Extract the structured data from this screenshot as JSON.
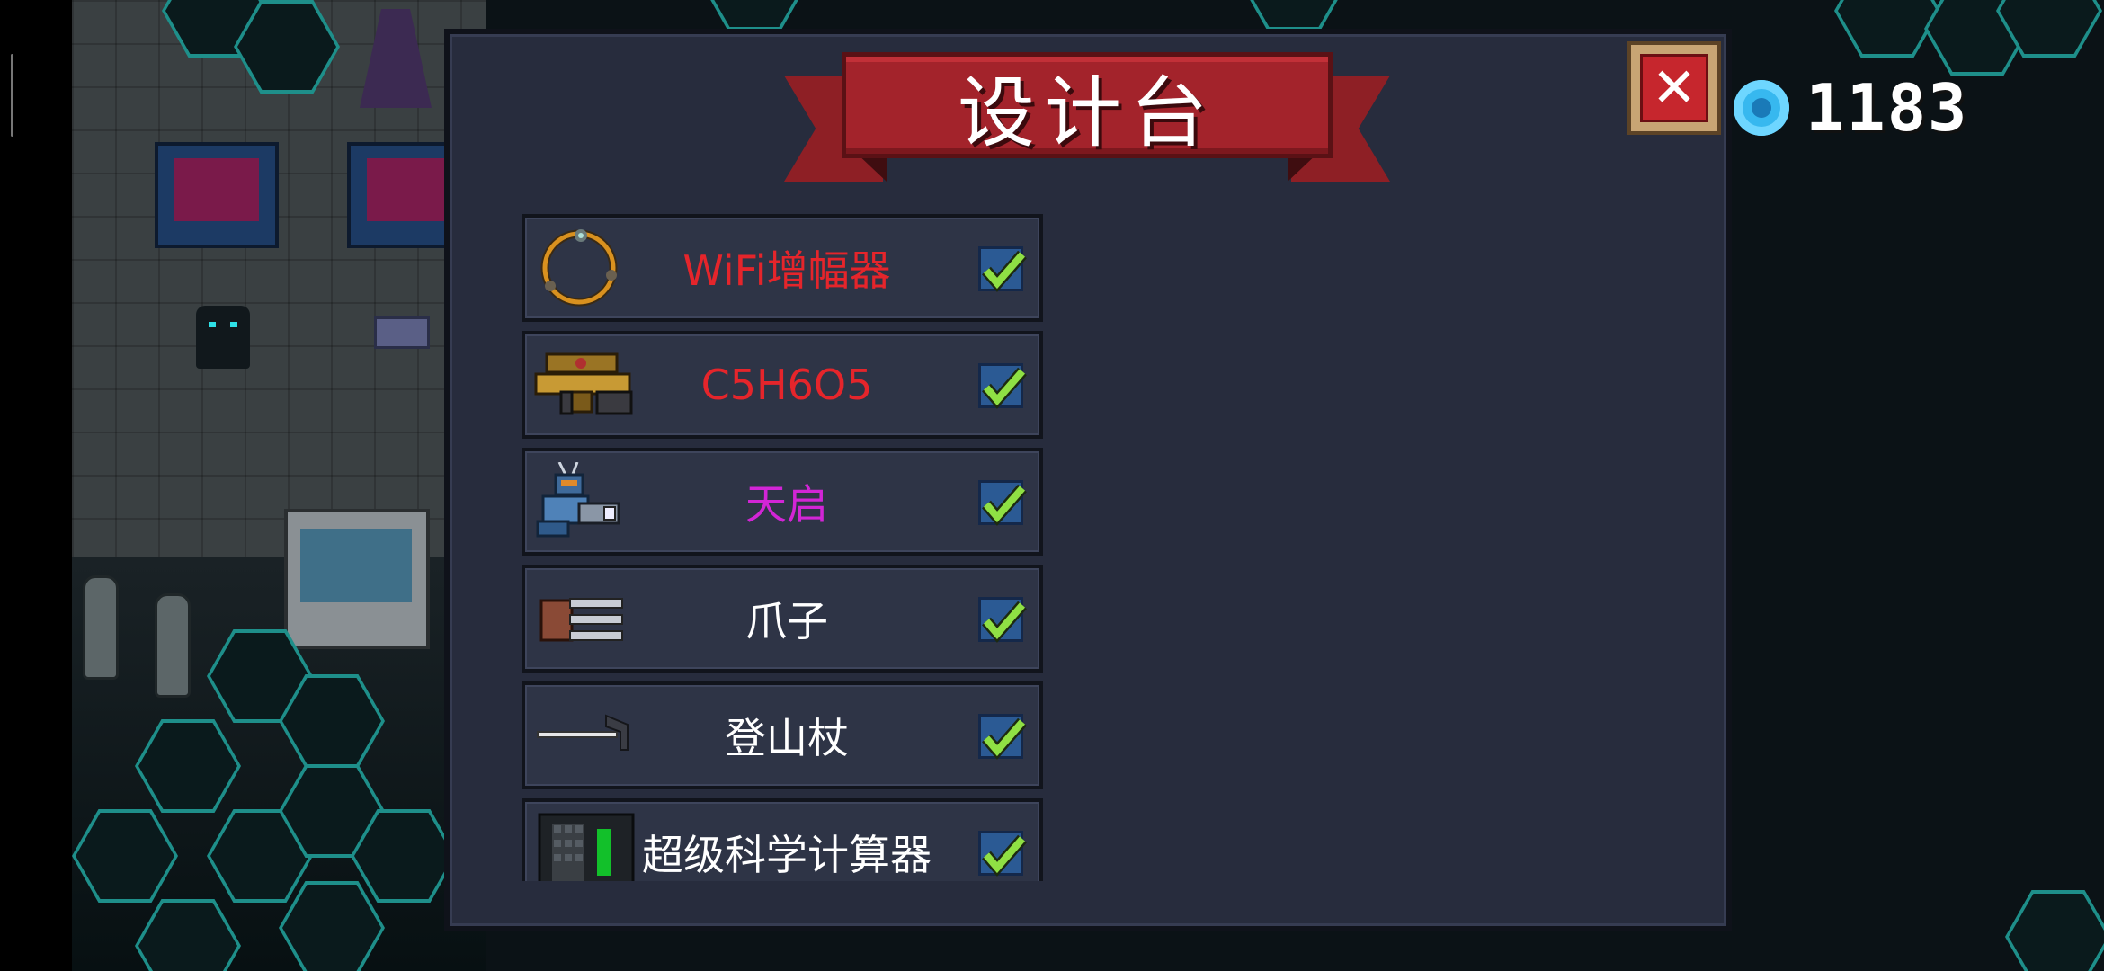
{
  "title": "设计台",
  "close_label": "✕",
  "currency": {
    "value": "1183",
    "icon": "blue-gem-icon"
  },
  "items": [
    {
      "label": "WiFi增幅器",
      "color": "#e5252b",
      "checked": true,
      "icon": "wifi-ring-icon"
    },
    {
      "label": "C5H6O5",
      "color": "#e5252b",
      "checked": true,
      "icon": "gold-blaster-icon"
    },
    {
      "label": "天启",
      "color": "#d225d6",
      "checked": true,
      "icon": "mech-rider-icon"
    },
    {
      "label": "爪子",
      "color": "#ffffff",
      "checked": true,
      "icon": "claw-icon"
    },
    {
      "label": "登山杖",
      "color": "#ffffff",
      "checked": true,
      "icon": "hiking-pick-icon"
    },
    {
      "label": "超级科学计算器",
      "color": "#ffffff",
      "checked": true,
      "icon": "calculator-icon"
    }
  ]
}
